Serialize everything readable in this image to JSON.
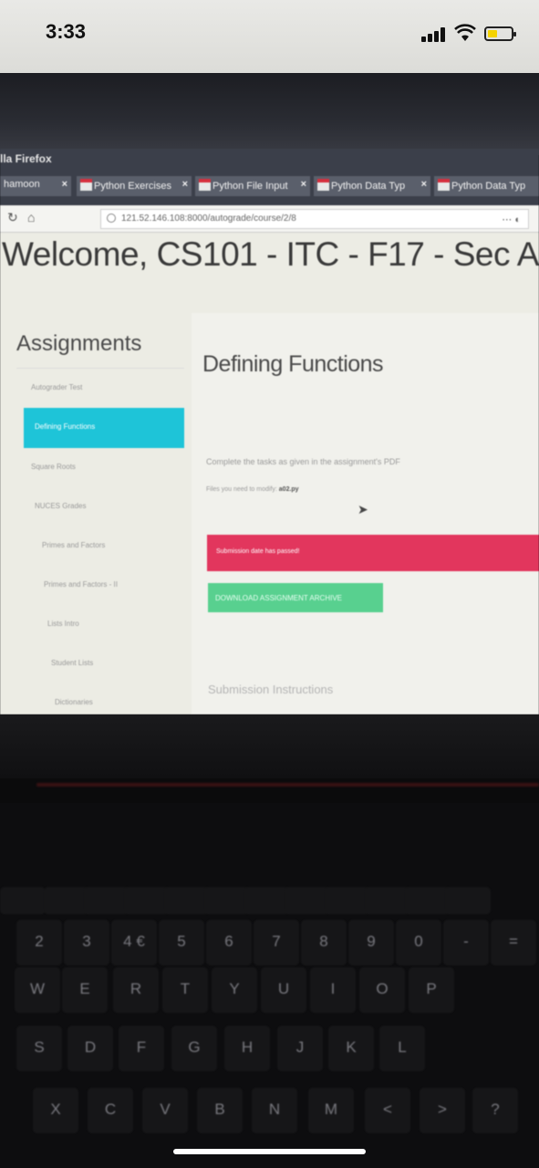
{
  "phone": {
    "time": "3:33"
  },
  "browser": {
    "window_title": "lla Firefox",
    "tabs": [
      {
        "label": "hamoon"
      },
      {
        "label": "Python Exercises"
      },
      {
        "label": "Python File Input"
      },
      {
        "label": "Python Data Typ"
      },
      {
        "label": "Python Data Typ"
      }
    ],
    "url": "121.52.146.108:8000/autograde/course/2/8"
  },
  "page": {
    "welcome": "Welcome, CS101 - ITC - F17 - Sec A",
    "sidebar": {
      "title": "Assignments",
      "items": [
        {
          "label": "Autograder Test"
        },
        {
          "label": "Defining Functions",
          "active": true
        },
        {
          "label": "Square Roots"
        },
        {
          "label": "NUCES Grades"
        },
        {
          "label": "Primes and Factors"
        },
        {
          "label": "Primes and Factors - II"
        },
        {
          "label": "Lists Intro"
        },
        {
          "label": "Student Lists"
        },
        {
          "label": "Dictionaries"
        }
      ]
    },
    "main": {
      "title": "Defining Functions",
      "task_text": "Complete the tasks as given in the assignment's PDF",
      "files_label": "Files you need to modify:",
      "files_value": "a02.py",
      "alert": "Submission date has passed!",
      "download_label": "DOWNLOAD ASSIGNMENT ARCHIVE",
      "submission_heading": "Submission Instructions"
    }
  },
  "keyboard": {
    "fn_row": [
      "",
      "",
      "",
      "",
      "",
      "",
      "",
      "",
      "",
      "",
      "",
      ""
    ],
    "number_row": [
      "2",
      "3",
      "4 €",
      "5",
      "6",
      "7",
      "8",
      "9",
      "0",
      "-",
      "="
    ],
    "row_q": [
      "W",
      "E",
      "R",
      "T",
      "Y",
      "U",
      "I",
      "O",
      "P"
    ],
    "row_a": [
      "S",
      "D",
      "F",
      "G",
      "H",
      "J",
      "K",
      "L"
    ],
    "row_z": [
      "X",
      "C",
      "V",
      "B",
      "N",
      "M",
      "<",
      ">",
      "?"
    ]
  },
  "colors": {
    "active_item": "#1ec4d8",
    "alert_bg": "#e2365d",
    "download_bg": "#58d08f",
    "battery": "#f5d300"
  }
}
